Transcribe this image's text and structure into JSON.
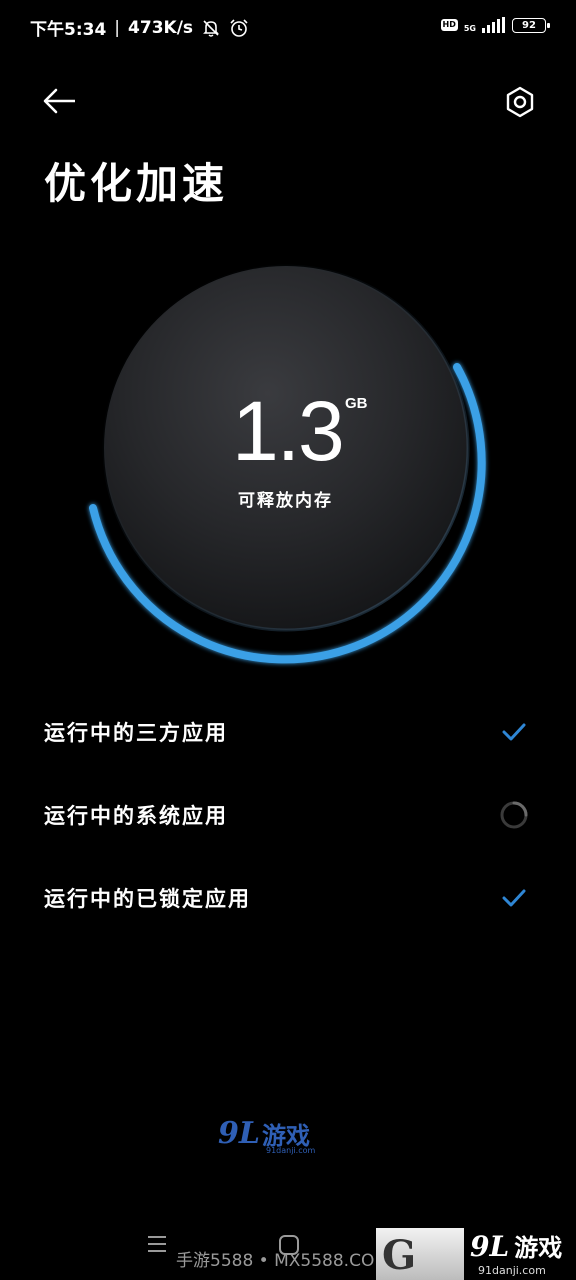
{
  "status_bar": {
    "time": "下午5:34",
    "net_speed": "473K/s",
    "hd": "HD",
    "network": "5G",
    "battery": "92"
  },
  "header": {
    "title": "优化加速"
  },
  "gauge": {
    "value": "1.3",
    "unit": "GB",
    "label": "可释放内存"
  },
  "options": [
    {
      "label": "运行中的三方应用",
      "status": "done"
    },
    {
      "label": "运行中的系统应用",
      "status": "loading"
    },
    {
      "label": "运行中的已锁定应用",
      "status": "done"
    }
  ],
  "colors": {
    "accent": "#2f86d4",
    "background": "#000000",
    "ring": "#3aa0e6"
  },
  "watermarks": {
    "bottom_text": "手游5588 • MX5588.COM",
    "logo_num": "9L",
    "logo_text": "游戏",
    "logo_sub": "91danji.com",
    "logo_mid_sub": "91danji.com",
    "box_letter": "G"
  }
}
